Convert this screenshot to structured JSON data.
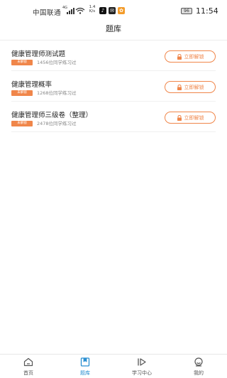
{
  "status_bar": {
    "carrier": "中国联通",
    "network_tag": "4G",
    "speed_value": "1.4",
    "speed_unit": "K/s",
    "battery": "96",
    "time": "11:54"
  },
  "header": {
    "title": "题库"
  },
  "banks": [
    {
      "title": "健康管理师测试题",
      "badge": "未解锁",
      "learners": "1456位同学练习过",
      "button": "立即解锁"
    },
    {
      "title": "健康管理概率",
      "badge": "未解锁",
      "learners": "1268位同学练习过",
      "button": "立即解锁"
    },
    {
      "title": "健康管理师三级卷（整理）",
      "badge": "未解锁",
      "learners": "2478位同学练习过",
      "button": "立即解锁"
    }
  ],
  "tabs": [
    {
      "label": "首页",
      "icon": "home-icon"
    },
    {
      "label": "题库",
      "icon": "question-bank-icon",
      "active": true
    },
    {
      "label": "学习中心",
      "icon": "play-icon"
    },
    {
      "label": "我的",
      "icon": "profile-icon"
    }
  ],
  "colors": {
    "accent": "#f0864a",
    "active_tab": "#2a8fd1"
  }
}
